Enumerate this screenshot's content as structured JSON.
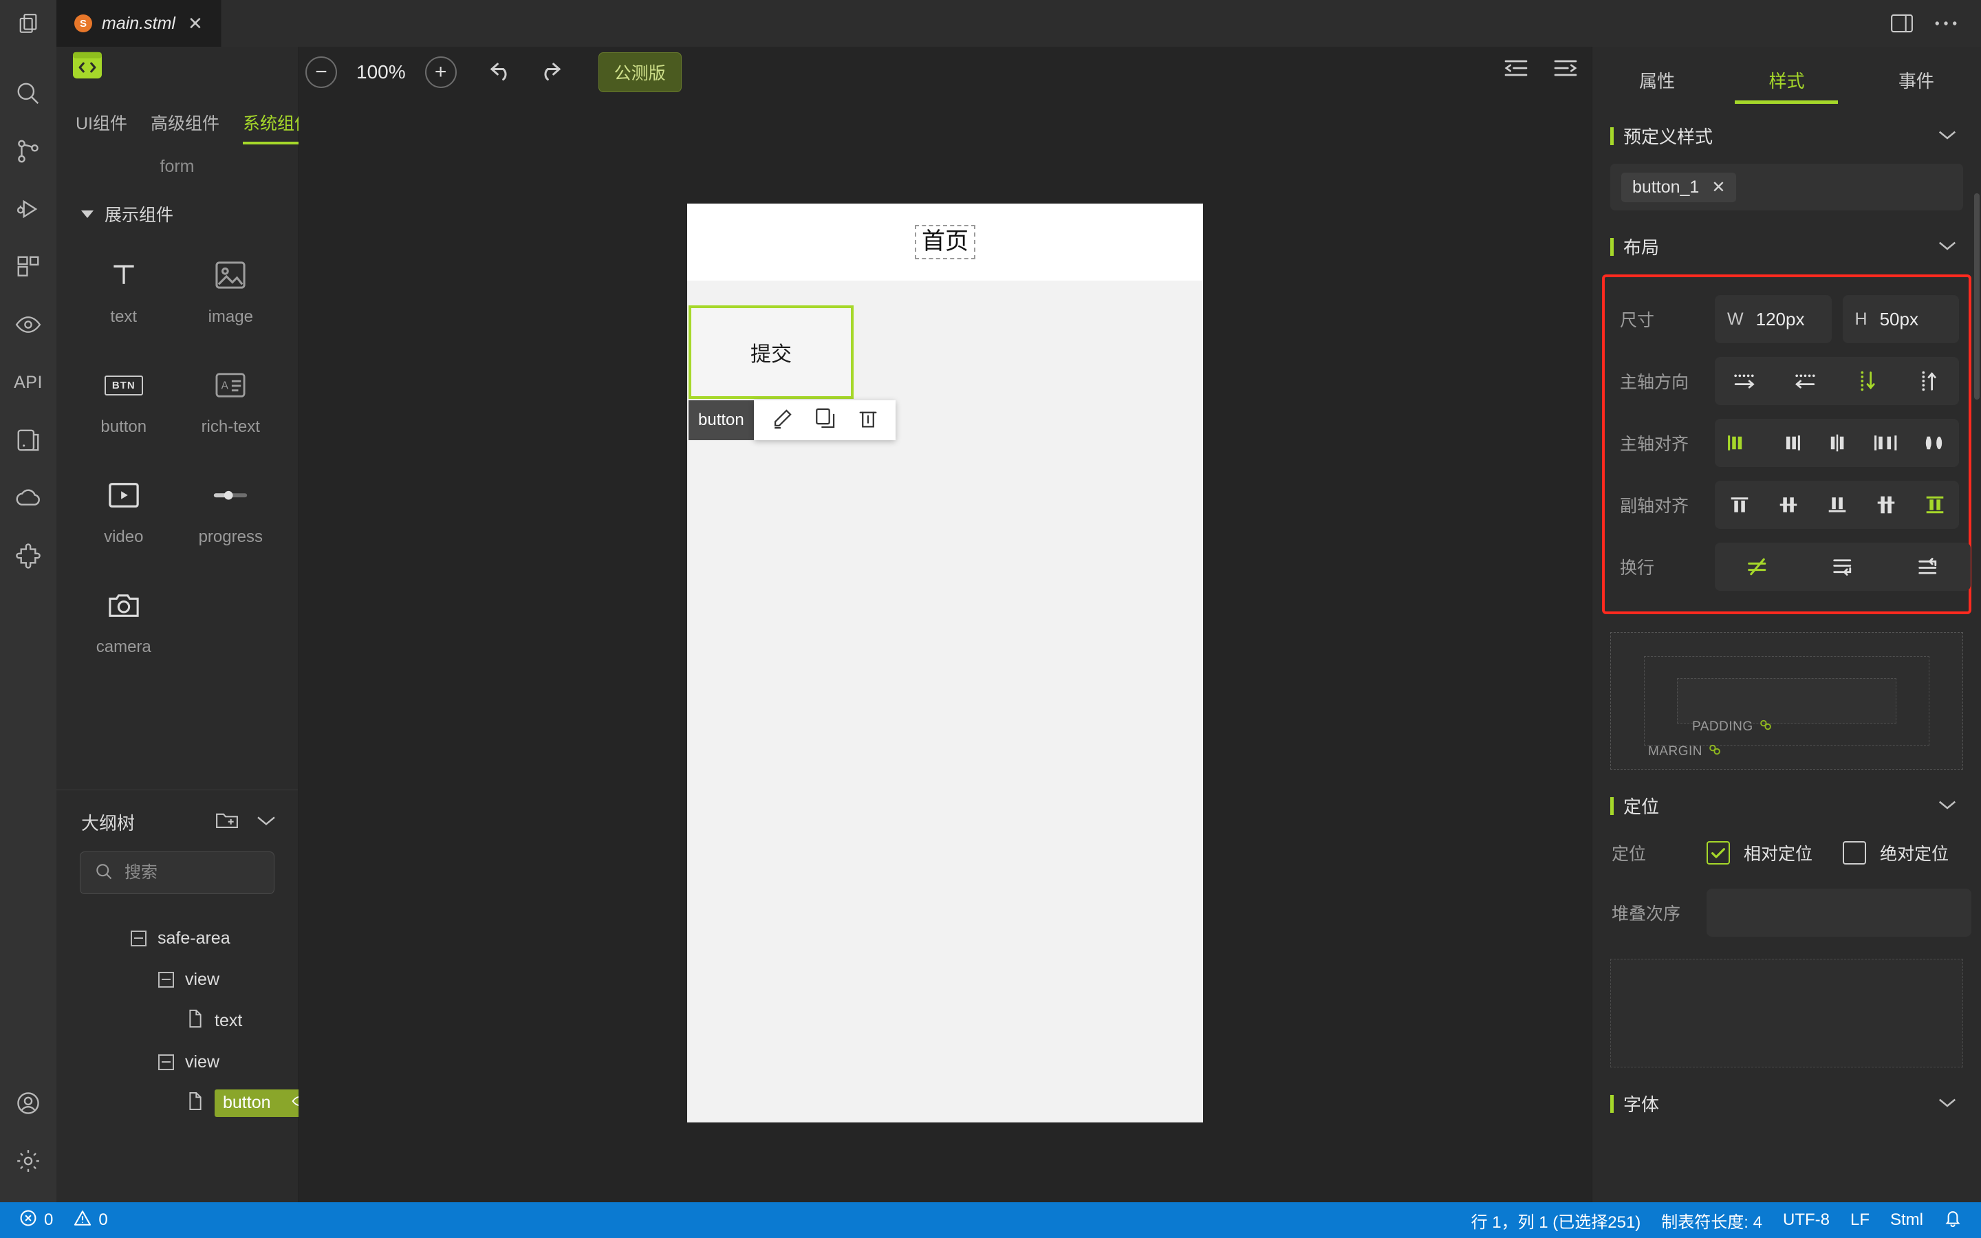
{
  "titlebar": {
    "tab": {
      "badge": "S",
      "label": "main.stml",
      "close": "✕"
    },
    "files_icon": "files-icon",
    "layout_icon": "panel-toggle-icon",
    "more_icon": "more-actions-icon"
  },
  "toolbar": {
    "code_icon": "code-block-icon",
    "zoom_out": "−",
    "zoom_level": "100%",
    "zoom_in": "+",
    "undo": "undo-icon",
    "redo": "redo-icon",
    "beta_badge": "公测版",
    "collapse_left_icon": "collapse-left-icon",
    "collapse_right_icon": "collapse-right-icon"
  },
  "activity": {
    "items": [
      {
        "name": "search-icon"
      },
      {
        "name": "source-control-icon"
      },
      {
        "name": "run-debug-icon"
      },
      {
        "name": "extensions-icon"
      },
      {
        "name": "preview-eye-icon"
      },
      {
        "name": "api-label",
        "label": "API"
      },
      {
        "name": "device-icon"
      },
      {
        "name": "cloud-icon"
      },
      {
        "name": "plugin-icon"
      }
    ],
    "bottom": [
      {
        "name": "account-icon"
      },
      {
        "name": "settings-gear-icon"
      }
    ]
  },
  "components": {
    "tabs": [
      {
        "label": "UI组件",
        "active": false
      },
      {
        "label": "高级组件",
        "active": false
      },
      {
        "label": "系统组件",
        "active": true
      }
    ],
    "form_group_label": "form",
    "display_group_label": "展示组件",
    "items": [
      {
        "label": "text",
        "icon": "text-T-icon"
      },
      {
        "label": "image",
        "icon": "image-icon"
      },
      {
        "label": "button",
        "icon": "button-btn-icon"
      },
      {
        "label": "rich-text",
        "icon": "rich-text-icon"
      },
      {
        "label": "video",
        "icon": "video-play-icon"
      },
      {
        "label": "progress",
        "icon": "progress-bar-icon"
      },
      {
        "label": "camera",
        "icon": "camera-icon"
      }
    ]
  },
  "outline": {
    "title": "大纲树",
    "new_folder_icon": "new-node-icon",
    "collapse_icon": "chevron-down-icon",
    "search_placeholder": "搜索",
    "search_value": "",
    "tree": [
      {
        "label": "safe-area",
        "depth": 0,
        "type": "container",
        "selected": false
      },
      {
        "label": "view",
        "depth": 1,
        "type": "container",
        "selected": false
      },
      {
        "label": "text",
        "depth": 2,
        "type": "leaf",
        "selected": false
      },
      {
        "label": "view",
        "depth": 1,
        "type": "container",
        "selected": false
      },
      {
        "label": "button",
        "depth": 2,
        "type": "leaf",
        "selected": true
      }
    ]
  },
  "canvas": {
    "page_title": "首页",
    "selected_button_label": "提交",
    "selection_tag": "button",
    "tools": [
      {
        "name": "edit-pencil-icon"
      },
      {
        "name": "duplicate-icon"
      },
      {
        "name": "delete-trash-icon"
      }
    ]
  },
  "inspector": {
    "tabs": [
      {
        "label": "属性",
        "active": false
      },
      {
        "label": "样式",
        "active": true
      },
      {
        "label": "事件",
        "active": false
      }
    ],
    "predefined": {
      "title": "预定义样式",
      "chip": "button_1",
      "chip_close": "✕"
    },
    "layout": {
      "title": "布局",
      "size_label": "尺寸",
      "width_key": "W",
      "width_value": "120px",
      "height_key": "H",
      "height_value": "50px",
      "main_axis_label": "主轴方向",
      "main_axis_active_index": 2,
      "main_axis_options": [
        "row",
        "row-reverse",
        "column",
        "column-reverse"
      ],
      "main_align_label": "主轴对齐",
      "main_align_active_index": 0,
      "main_align_options": [
        "flex-start",
        "flex-end",
        "center",
        "space-between",
        "space-around"
      ],
      "cross_align_label": "副轴对齐",
      "cross_align_active_index": 4,
      "cross_align_options": [
        "flex-start",
        "center",
        "flex-end",
        "baseline",
        "stretch"
      ],
      "wrap_label": "换行",
      "wrap_active_index": 0,
      "wrap_options": [
        "nowrap",
        "wrap",
        "wrap-reverse"
      ]
    },
    "boxmodel": {
      "padding_label": "PADDING",
      "margin_label": "MARGIN",
      "link_icon": "link-icon"
    },
    "position": {
      "title": "定位",
      "row_label": "定位",
      "relative_label": "相对定位",
      "relative_checked": true,
      "absolute_label": "绝对定位",
      "absolute_checked": false,
      "zindex_label": "堆叠次序",
      "zindex_value": ""
    },
    "font": {
      "title": "字体"
    }
  },
  "statusbar": {
    "errors_icon": "error-circle-icon",
    "errors": "0",
    "warnings_icon": "warning-triangle-icon",
    "warnings": "0",
    "cursor": "行 1，列 1 (已选择251)",
    "tab_size": "制表符长度: 4",
    "encoding": "UTF-8",
    "eol": "LF",
    "language": "Stml",
    "bell_icon": "bell-icon"
  },
  "colors": {
    "accent": "#a6d82a",
    "highlight": "#ff2a1f",
    "status_bg": "#0b7ad1",
    "panel_bg": "#2b2b2b",
    "activity_bg": "#333333",
    "tab_orange": "#e8772a"
  }
}
